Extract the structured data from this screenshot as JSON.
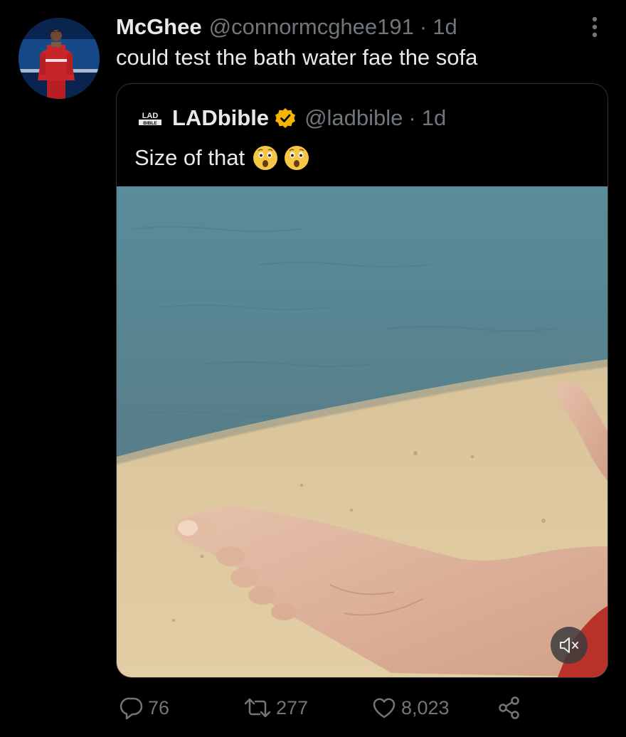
{
  "author": {
    "name": "McGhee",
    "handle": "@connormcghee191",
    "separator": "·",
    "time": "1d"
  },
  "tweet": {
    "text": "could test the bath water fae the sofa"
  },
  "quoted": {
    "logo_text": "LAD BIBLE",
    "name": "LADbible",
    "handle": "@ladbible",
    "separator": "·",
    "time": "1d",
    "text": "Size of that",
    "emojis": [
      "astonished-face-icon",
      "astonished-face-icon"
    ],
    "verified_color": "#f4b400"
  },
  "actions": {
    "replies": "76",
    "retweets": "277",
    "likes": "8,023"
  },
  "colors": {
    "background": "#000000",
    "text": "#e7e9ea",
    "muted": "#71767b",
    "border": "#2f3336"
  }
}
